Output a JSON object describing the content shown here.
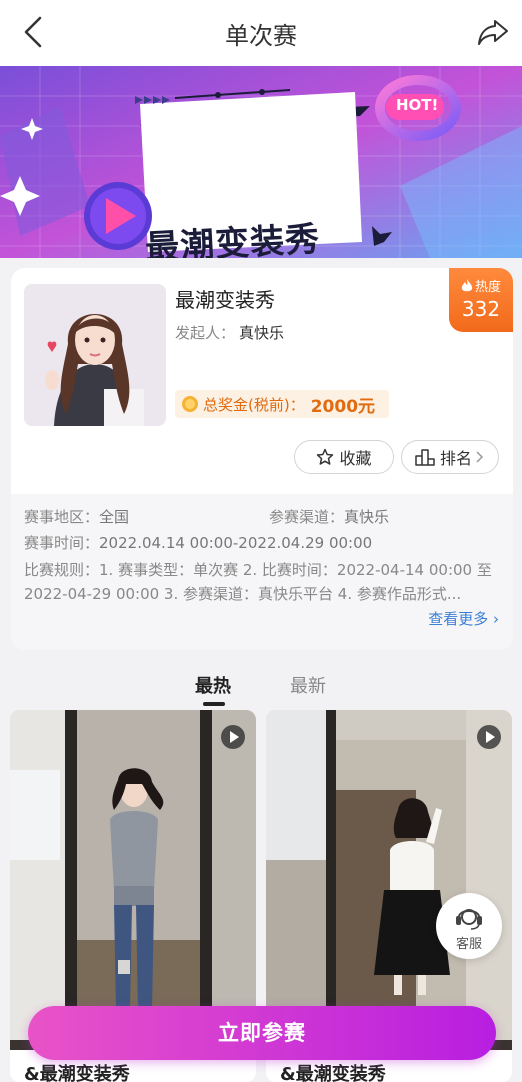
{
  "header": {
    "title": "单次赛",
    "back_icon": "back-chevron-icon",
    "share_icon": "share-arrow-icon"
  },
  "banner": {
    "headline": "最潮变装秀",
    "hot_label": "HOT!"
  },
  "contest": {
    "name": "最潮变装秀",
    "organizer_label": "发起人：",
    "organizer": "真快乐",
    "prize_label": "总奖金(税前)：",
    "prize_amount": "2000元",
    "heat_label": "热度",
    "heat_value": "332",
    "favorite_label": "收藏",
    "rank_label": "排名"
  },
  "info": {
    "region_label": "赛事地区：",
    "region": "全国",
    "channel_label": "参赛渠道：",
    "channel": "真快乐",
    "time_label": "赛事时间：",
    "time": "2022.04.14 00:00-2022.04.29 00:00",
    "rules_text": "比赛规则：1. 赛事类型：单次赛 2. 比赛时间：2022-04-14 00:00 至 2022-04-29 00:00 3. 参赛渠道：真快乐平台 4. 参赛作品形式...",
    "more_label": "查看更多"
  },
  "tabs": [
    {
      "label": "最热"
    },
    {
      "label": "最新"
    }
  ],
  "feed": [
    {
      "caption": "&最潮变装秀"
    },
    {
      "caption": "&最潮变装秀"
    }
  ],
  "service_label": "客服",
  "cta_label": "立即参赛",
  "colors": {
    "accent": "#c72be0",
    "heat": "#f26a1b",
    "prize": "#e06b10",
    "link": "#3b7fd6"
  }
}
